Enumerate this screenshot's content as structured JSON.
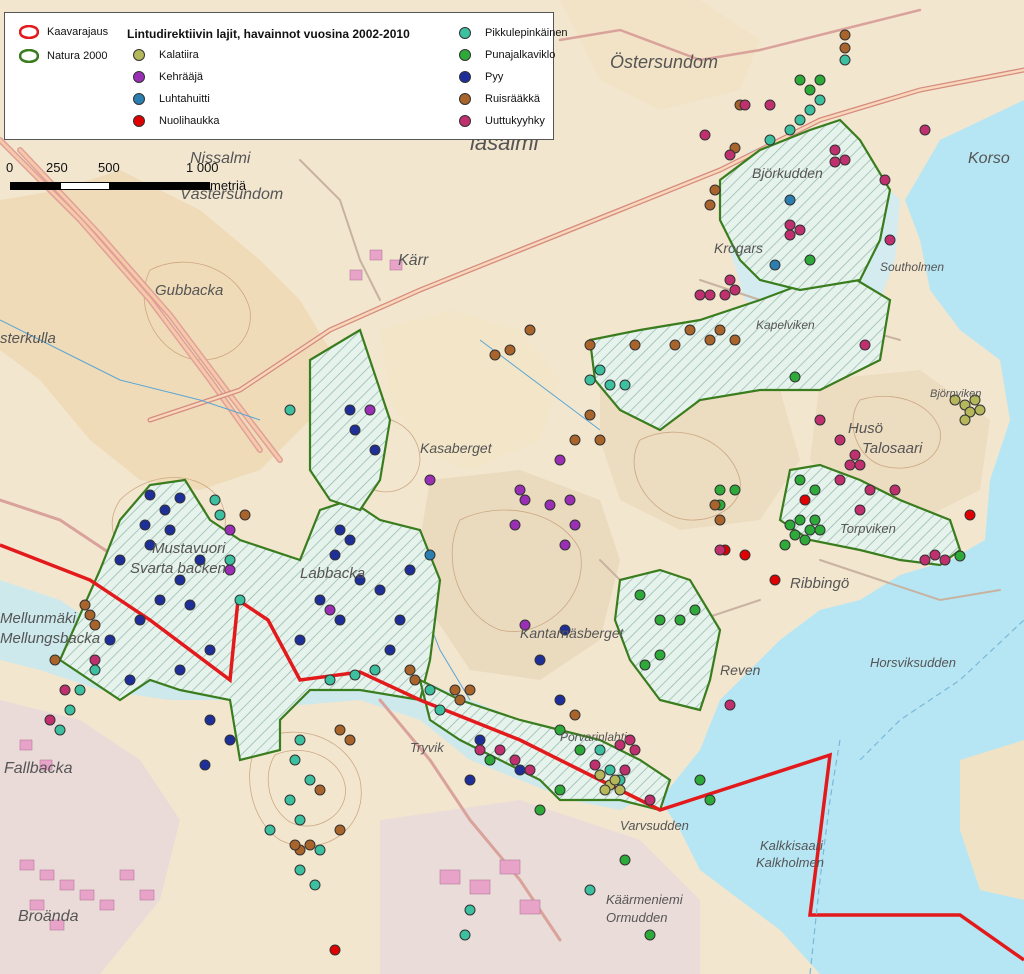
{
  "legend": {
    "title": "Lintudirektiivin lajit, havainnot vuosina 2002-2010",
    "boundary_items": [
      {
        "label": "Kaavarajaus",
        "color": "#e31a1c",
        "icon": "kaavarajaus-outline-icon"
      },
      {
        "label": "Natura 2000",
        "color": "#3a7d1e",
        "icon": "natura-outline-icon"
      }
    ],
    "species_col1": [
      {
        "label": "Kalatiira",
        "color": "#b5b75a"
      },
      {
        "label": "Kehrääjä",
        "color": "#9a2fb5"
      },
      {
        "label": "Luhtahuitti",
        "color": "#2b7fb0"
      },
      {
        "label": "Nuolihaukka",
        "color": "#e00000"
      }
    ],
    "species_col2": [
      {
        "label": "Pikkulepinkäinen",
        "color": "#3cc0a0"
      },
      {
        "label": "Punajalkaviklo",
        "color": "#2eaa3a"
      },
      {
        "label": "Pyy",
        "color": "#1f2f9a"
      },
      {
        "label": "Ruisrääkkä",
        "color": "#a8642a"
      },
      {
        "label": "Uuttukyyhky",
        "color": "#c0306e"
      }
    ]
  },
  "scale": {
    "labels": [
      "0",
      "250",
      "500",
      "1 000"
    ],
    "unit": "metriä"
  },
  "place_labels": [
    {
      "text": "Östersundom",
      "size": 18
    },
    {
      "text": "Björkudden",
      "size": 14
    },
    {
      "text": "Krogars",
      "size": 14
    },
    {
      "text": "Kärr",
      "size": 16
    },
    {
      "text": "Gubbacka",
      "size": 15
    },
    {
      "text": "sterkulla",
      "size": 15
    },
    {
      "text": "Kasaberget",
      "size": 14
    },
    {
      "text": "Kapelviken",
      "size": 12
    },
    {
      "text": "Husö",
      "size": 15
    },
    {
      "text": "Talosaari",
      "size": 15
    },
    {
      "text": "Torpviken",
      "size": 13
    },
    {
      "text": "Ribbingö",
      "size": 15
    },
    {
      "text": "Kantarnäsberget",
      "size": 14
    },
    {
      "text": "Reven",
      "size": 14
    },
    {
      "text": "Horsviksudden",
      "size": 13
    },
    {
      "text": "Varvsudden",
      "size": 13
    },
    {
      "text": "Kalkkisaari",
      "size": 13
    },
    {
      "text": "Kalkholmen",
      "size": 13
    },
    {
      "text": "Käärmeniemi",
      "size": 13
    },
    {
      "text": "Ormudden",
      "size": 13
    },
    {
      "text": "Fallbacka",
      "size": 16
    },
    {
      "text": "Broända",
      "size": 16
    },
    {
      "text": "Tryvik",
      "size": 13
    },
    {
      "text": "Labbacka",
      "size": 15
    },
    {
      "text": "Mustavuori",
      "size": 15
    },
    {
      "text": "Svarta backen",
      "size": 15
    },
    {
      "text": "Southolmen",
      "size": 12
    },
    {
      "text": "Korso",
      "size": 16
    },
    {
      "text": "Mellunmäki",
      "size": 15
    },
    {
      "text": "Mellungsbacka",
      "size": 15
    },
    {
      "text": "Nissalmi",
      "size": 16
    },
    {
      "text": "Västersundom",
      "size": 16
    },
    {
      "text": "lasalmi",
      "size": 22
    },
    {
      "text": "Porvarinlahti",
      "size": 12
    },
    {
      "text": "Björnviken",
      "size": 11
    }
  ]
}
